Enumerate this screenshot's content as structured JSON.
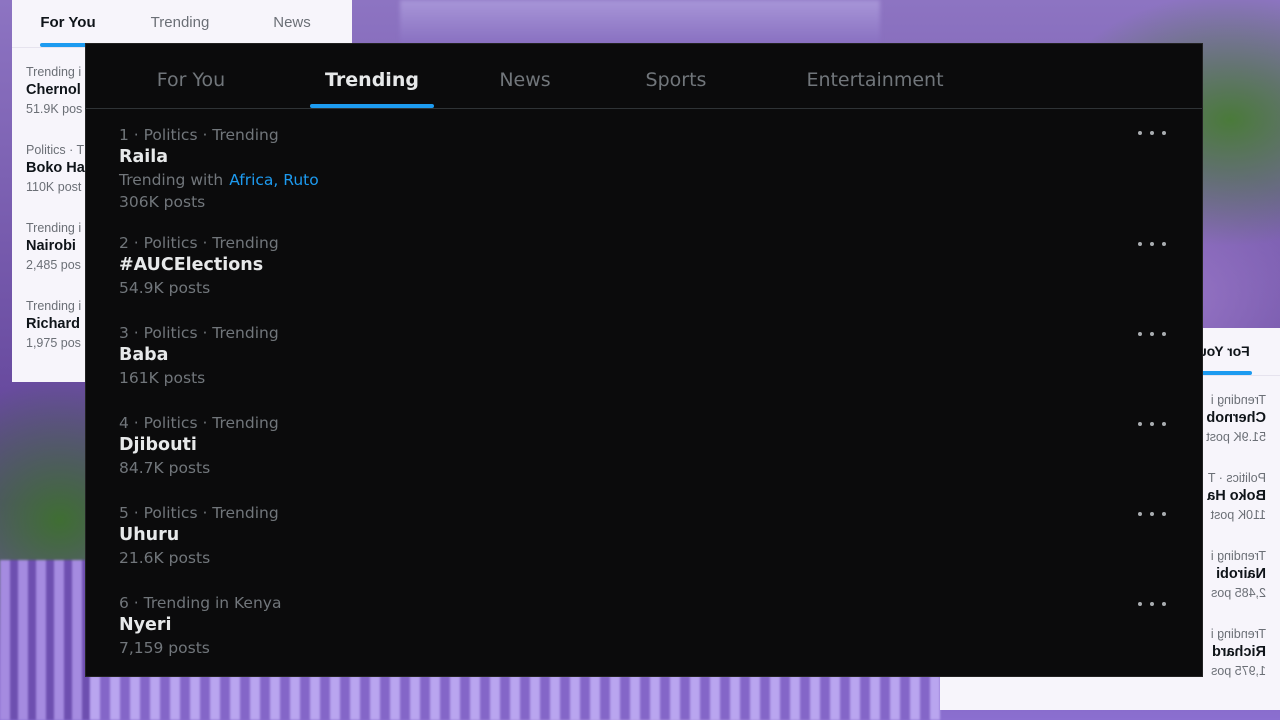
{
  "left_panel": {
    "tabs": [
      "For You",
      "Trending",
      "News"
    ],
    "items": [
      {
        "meta": "Trending i",
        "name": "Chernol",
        "posts": "51.9K pos"
      },
      {
        "meta": "Politics · T",
        "name": "Boko Ha",
        "posts": "110K post"
      },
      {
        "meta": "Trending i",
        "name": "Nairobi",
        "posts": "2,485 pos"
      },
      {
        "meta": "Trending i",
        "name": "Richard",
        "posts": "1,975 pos"
      }
    ]
  },
  "right_panel": {
    "tabs": [
      "For You"
    ],
    "items": [
      {
        "meta": "Trending i",
        "name": "Chernob",
        "posts": "51.9K post"
      },
      {
        "meta": "Politics · T",
        "name": "Boko Ha",
        "posts": "110K post"
      },
      {
        "meta": "Trending i",
        "name": "Nairobi",
        "posts": "2,485 pos"
      },
      {
        "meta": "Trending i",
        "name": "Richard",
        "posts": "1,975 pos"
      }
    ]
  },
  "main": {
    "tabs": [
      "For You",
      "Trending",
      "News",
      "Sports",
      "Entertainment"
    ],
    "active_tab": "Trending",
    "accent_color": "#1d9bf0",
    "trends": [
      {
        "meta": "1 · Politics · Trending",
        "name": "Raila",
        "with_label": "Trending with",
        "with_links": "Africa, Ruto",
        "posts": "306K posts"
      },
      {
        "meta": "2 · Politics · Trending",
        "name": "#AUCElections",
        "posts": "54.9K posts"
      },
      {
        "meta": "3 · Politics · Trending",
        "name": "Baba",
        "posts": "161K posts"
      },
      {
        "meta": "4 · Politics · Trending",
        "name": "Djibouti",
        "posts": "84.7K posts"
      },
      {
        "meta": "5 · Politics · Trending",
        "name": "Uhuru",
        "posts": "21.6K posts"
      },
      {
        "meta": "6 · Trending in Kenya",
        "name": "Nyeri",
        "posts": "7,159 posts"
      }
    ]
  }
}
